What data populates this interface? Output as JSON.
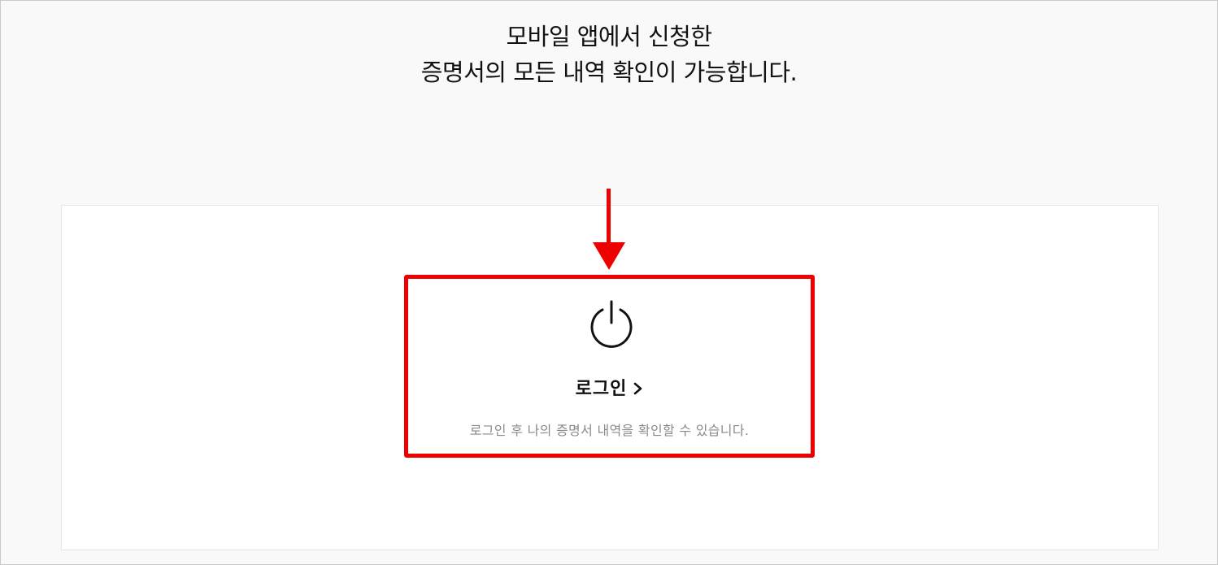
{
  "header": {
    "line1": "모바일 앱에서 신청한",
    "line2": "증명서의 모든 내역 확인이 가능합니다."
  },
  "login_card": {
    "icon": "power-icon",
    "label": "로그인",
    "chevron_icon": "chevron-right-icon",
    "description": "로그인 후 나의 증명서 내역을 확인할 수 있습니다."
  },
  "annotation": {
    "arrow_color": "#ee0000",
    "box_color": "#ee0000"
  }
}
